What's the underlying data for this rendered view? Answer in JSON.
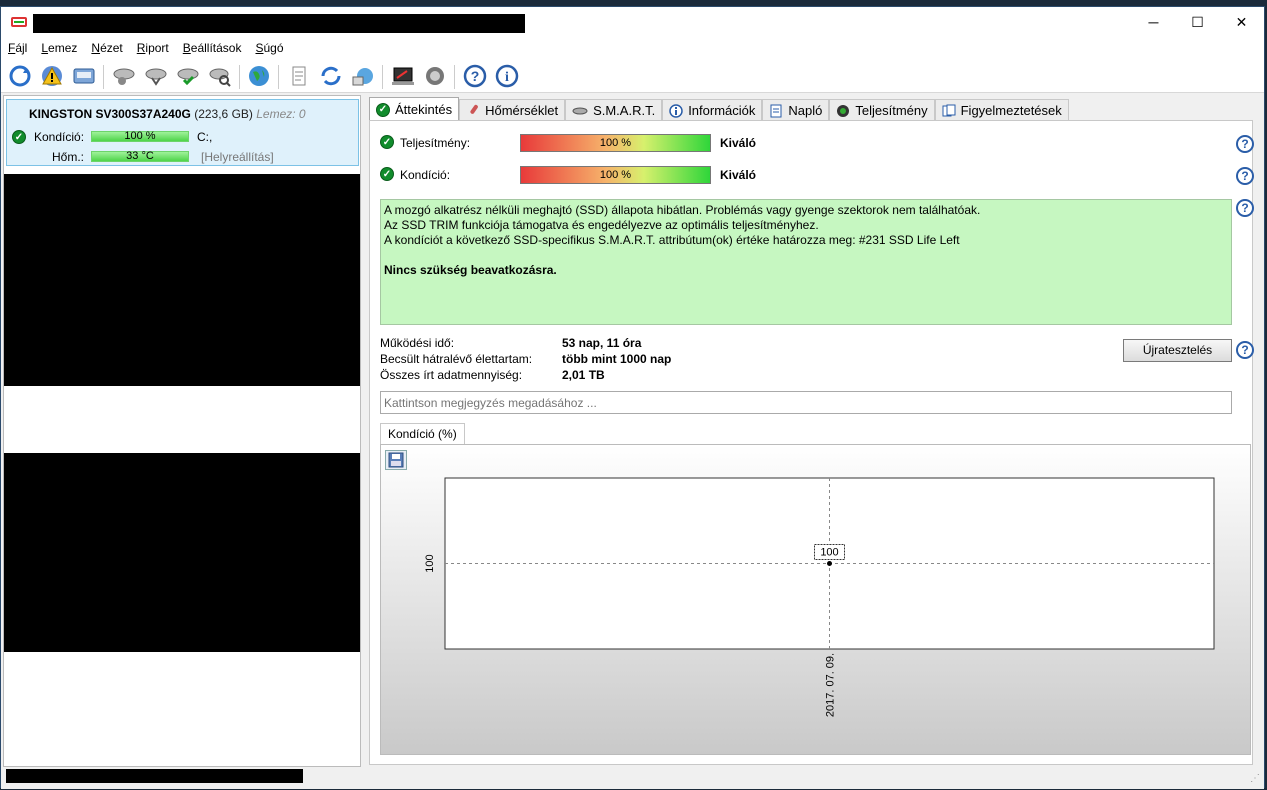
{
  "window": {
    "controls": {
      "minimize": "─",
      "maximize": "☐",
      "close": "✕"
    }
  },
  "menu": [
    {
      "label": "Fájl",
      "key": "F"
    },
    {
      "label": "Lemez",
      "key": "L"
    },
    {
      "label": "Nézet",
      "key": "N"
    },
    {
      "label": "Riport",
      "key": "R"
    },
    {
      "label": "Beállítások",
      "key": "B"
    },
    {
      "label": "Súgó",
      "key": "S"
    }
  ],
  "toolbar": {
    "icons": [
      "refresh-icon",
      "alert-icon",
      "disk-icon",
      "disk-tool-1-icon",
      "disk-tool-2-icon",
      "disk-check-icon",
      "disk-search-icon",
      "globe-icon",
      "report-icon",
      "sync-icon",
      "network-icon",
      "terminal-icon",
      "speaker-icon",
      "help-icon",
      "info-icon"
    ]
  },
  "disk": {
    "name": "KINGSTON SV300S37A240G",
    "size": "(223,6 GB)",
    "lemez": "Lemez: 0",
    "kondicio_label": "Kondíció:",
    "kondicio_value": "100 %",
    "drive": "C:,",
    "hom_label": "Hőm.:",
    "hom_value": "33 °C",
    "hom_extra": "[Helyreállítás]"
  },
  "tabs": [
    {
      "label": "Áttekintés",
      "icon": "check-icon",
      "active": true
    },
    {
      "label": "Hőmérséklet",
      "icon": "thermometer-icon"
    },
    {
      "label": "S.M.A.R.T.",
      "icon": "smart-disk-icon"
    },
    {
      "label": "Információk",
      "icon": "info-icon"
    },
    {
      "label": "Napló",
      "icon": "log-icon"
    },
    {
      "label": "Teljesítmény",
      "icon": "gauge-icon"
    },
    {
      "label": "Figyelmeztetések",
      "icon": "warnings-icon"
    }
  ],
  "overview": {
    "teljesitmeny_label": "Teljesítmény:",
    "teljesitmeny_value": "100 %",
    "teljesitmeny_status": "Kiváló",
    "kondicio_label": "Kondíció:",
    "kondicio_value": "100 %",
    "kondicio_status": "Kiváló",
    "info_lines": [
      "A mozgó alkatrész nélküli meghajtó (SSD) állapota hibátlan. Problémás vagy gyenge szektorok nem találhatóak.",
      "Az SSD TRIM funkciója támogatva és engedélyezve az optimális teljesítményhez.",
      "A kondíciót a következő SSD-specifikus S.M.A.R.T. attribútum(ok) értéke határozza meg:  #231 SSD Life Left"
    ],
    "info_bold": "Nincs szükség beavatkozásra.",
    "stats": [
      {
        "label": "Működési idő:",
        "value": "53 nap, 11 óra"
      },
      {
        "label": "Becsült hátralévő élettartam:",
        "value": "több mint 1000 nap"
      },
      {
        "label": "Összes írt adatmennyiség:",
        "value": "2,01 TB"
      }
    ],
    "retest_label": "Újratesztelés",
    "note_placeholder": "Kattintson megjegyzés megadásához ...",
    "chart_tab": "Kondíció  (%)"
  },
  "chart_data": {
    "type": "scatter",
    "x": [
      "2017. 07. 09."
    ],
    "y": [
      100
    ],
    "data_labels": [
      "100"
    ],
    "yticks": [
      "100"
    ],
    "grid": true
  },
  "colors": {
    "accent_blue": "#2a5da8",
    "ok_green": "#118c2c",
    "info_bg": "#c6f7c1"
  }
}
